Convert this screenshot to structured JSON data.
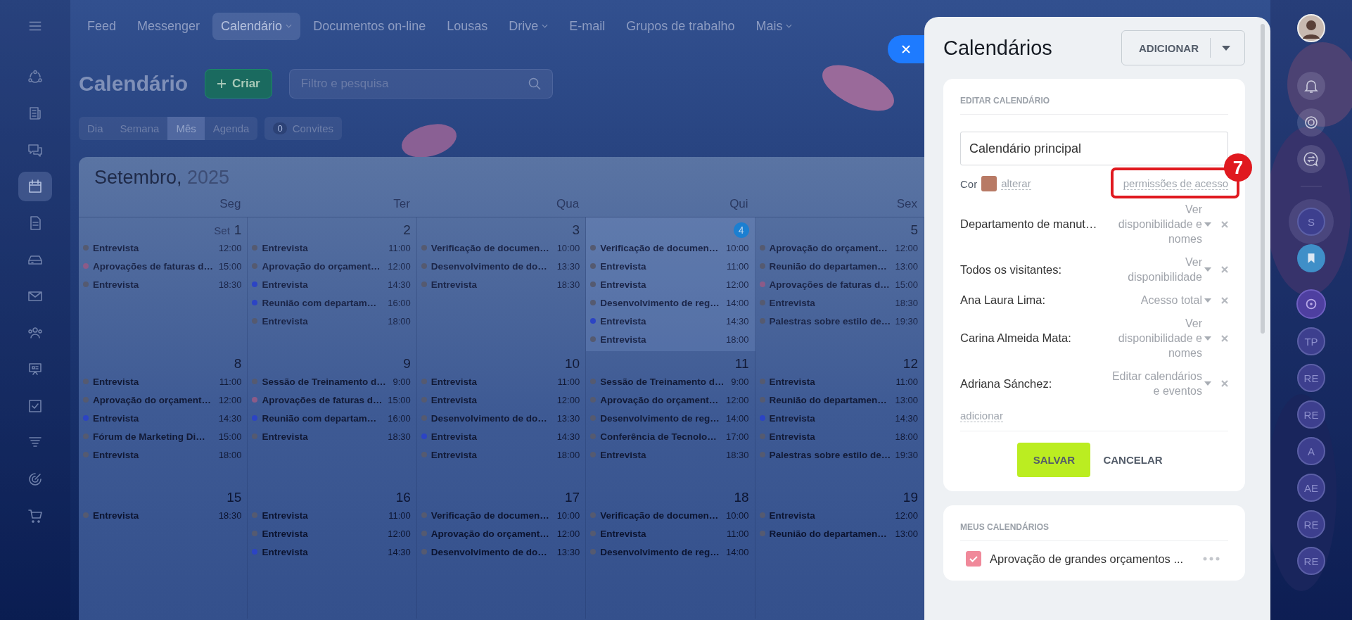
{
  "sidebar": {
    "items": [
      {
        "kind": "network",
        "selected": false
      },
      {
        "kind": "news",
        "selected": false
      },
      {
        "kind": "chat",
        "selected": false
      },
      {
        "kind": "calendar",
        "selected": true
      },
      {
        "kind": "document",
        "selected": false
      },
      {
        "kind": "drive",
        "selected": false
      },
      {
        "kind": "mail",
        "selected": false
      },
      {
        "kind": "people",
        "selected": false
      },
      {
        "kind": "board",
        "selected": false
      },
      {
        "kind": "tasks",
        "selected": false
      },
      {
        "kind": "funnel",
        "selected": false
      },
      {
        "kind": "target",
        "selected": false
      },
      {
        "kind": "cart",
        "selected": false
      }
    ]
  },
  "nav": {
    "items": [
      {
        "label": "Feed",
        "selected": false,
        "dropdown": false
      },
      {
        "label": "Messenger",
        "selected": false,
        "dropdown": false
      },
      {
        "label": "Calendário",
        "selected": true,
        "dropdown": true
      },
      {
        "label": "Documentos on-line",
        "selected": false,
        "dropdown": false
      },
      {
        "label": "Lousas",
        "selected": false,
        "dropdown": false
      },
      {
        "label": "Drive",
        "selected": false,
        "dropdown": true
      },
      {
        "label": "E-mail",
        "selected": false,
        "dropdown": false
      },
      {
        "label": "Grupos de trabalho",
        "selected": false,
        "dropdown": false
      },
      {
        "label": "Mais",
        "selected": false,
        "dropdown": true
      }
    ]
  },
  "header": {
    "title": "Calendário",
    "create_button": "Criar",
    "search": {
      "placeholder": "Filtro e pesquisa"
    }
  },
  "views": [
    {
      "label": "Dia",
      "selected": false
    },
    {
      "label": "Semana",
      "selected": false
    },
    {
      "label": "Mês",
      "selected": true
    },
    {
      "label": "Agenda",
      "selected": false
    }
  ],
  "invites": {
    "count": "0",
    "label": "Convites"
  },
  "calendar": {
    "month": "Setembro,",
    "year": "2025",
    "weekdays": [
      "Seg",
      "Ter",
      "Qua",
      "Qui",
      "Sex"
    ],
    "weeks": [
      {
        "days": [
          {
            "month": "Set",
            "number": "1",
            "today": false,
            "events": [
              {
                "title": "Entrevista",
                "time": "12:00",
                "color": "#555a70"
              },
              {
                "title": "Aprovações de faturas d…",
                "time": "15:00",
                "color": "#8c5b88"
              },
              {
                "title": "Entrevista",
                "time": "18:30",
                "color": "#555a70"
              }
            ]
          },
          {
            "number": "2",
            "today": false,
            "events": [
              {
                "title": "Entrevista",
                "time": "11:00",
                "color": "#555a70"
              },
              {
                "title": "Aprovação do orçament…",
                "time": "12:00",
                "color": "#555a70"
              },
              {
                "title": "Entrevista",
                "time": "14:30",
                "color": "#2c44c4"
              },
              {
                "title": "Reunião com departam…",
                "time": "16:00",
                "color": "#2c44c4"
              },
              {
                "title": "Entrevista",
                "time": "18:00",
                "color": "#555a70"
              }
            ]
          },
          {
            "number": "3",
            "today": false,
            "events": [
              {
                "title": "Verificação de documen…",
                "time": "10:00",
                "color": "#555a70"
              },
              {
                "title": "Desenvolvimento de do…",
                "time": "13:30",
                "color": "#555a70"
              },
              {
                "title": "Entrevista",
                "time": "18:30",
                "color": "#555a70"
              }
            ]
          },
          {
            "number": "4",
            "today": true,
            "events": [
              {
                "title": "Verificação de documen…",
                "time": "10:00",
                "color": "#555a70"
              },
              {
                "title": "Entrevista",
                "time": "11:00",
                "color": "#555a70"
              },
              {
                "title": "Entrevista",
                "time": "12:00",
                "color": "#555a70"
              },
              {
                "title": "Desenvolvimento de reg…",
                "time": "14:00",
                "color": "#555a70"
              },
              {
                "title": "Entrevista",
                "time": "14:30",
                "color": "#2c44c4"
              },
              {
                "title": "Entrevista",
                "time": "18:00",
                "color": "#555a70"
              }
            ]
          },
          {
            "number": "5",
            "today": false,
            "events": [
              {
                "title": "Aprovação do orçament…",
                "time": "12:00",
                "color": "#555a70"
              },
              {
                "title": "Reunião do departamen…",
                "time": "13:00",
                "color": "#555a70"
              },
              {
                "title": "Aprovações de faturas d…",
                "time": "15:00",
                "color": "#8c5b88"
              },
              {
                "title": "Entrevista",
                "time": "18:30",
                "color": "#555a70"
              },
              {
                "title": "Palestras sobre estilo de…",
                "time": "19:30",
                "color": "#555a70"
              }
            ]
          }
        ]
      },
      {
        "days": [
          {
            "number": "8",
            "today": false,
            "events": [
              {
                "title": "Entrevista",
                "time": "11:00",
                "color": "#555a70"
              },
              {
                "title": "Aprovação do orçament…",
                "time": "12:00",
                "color": "#555a70"
              },
              {
                "title": "Entrevista",
                "time": "14:30",
                "color": "#2c44c4"
              },
              {
                "title": "Fórum de Marketing Di…",
                "time": "15:00",
                "color": "#555a70"
              },
              {
                "title": "Entrevista",
                "time": "18:00",
                "color": "#555a70"
              }
            ]
          },
          {
            "number": "9",
            "today": false,
            "events": [
              {
                "title": "Sessão de Treinamento d…",
                "time": "9:00",
                "color": "#555a70"
              },
              {
                "title": "Aprovações de faturas d…",
                "time": "15:00",
                "color": "#8c5b88"
              },
              {
                "title": "Reunião com departam…",
                "time": "16:00",
                "color": "#2c44c4"
              },
              {
                "title": "Entrevista",
                "time": "18:30",
                "color": "#555a70"
              }
            ]
          },
          {
            "number": "10",
            "today": false,
            "events": [
              {
                "title": "Entrevista",
                "time": "11:00",
                "color": "#555a70"
              },
              {
                "title": "Entrevista",
                "time": "12:00",
                "color": "#555a70"
              },
              {
                "title": "Desenvolvimento de do…",
                "time": "13:30",
                "color": "#555a70"
              },
              {
                "title": "Entrevista",
                "time": "14:30",
                "color": "#2c44c4"
              },
              {
                "title": "Entrevista",
                "time": "18:00",
                "color": "#555a70"
              }
            ]
          },
          {
            "number": "11",
            "today": false,
            "events": [
              {
                "title": "Sessão de Treinamento d…",
                "time": "9:00",
                "color": "#555a70"
              },
              {
                "title": "Aprovação do orçament…",
                "time": "12:00",
                "color": "#555a70"
              },
              {
                "title": "Desenvolvimento de reg…",
                "time": "14:00",
                "color": "#555a70"
              },
              {
                "title": "Conferência de Tecnolo…",
                "time": "17:00",
                "color": "#555a70"
              },
              {
                "title": "Entrevista",
                "time": "18:30",
                "color": "#555a70"
              }
            ]
          },
          {
            "number": "12",
            "today": false,
            "events": [
              {
                "title": "Entrevista",
                "time": "11:00",
                "color": "#555a70"
              },
              {
                "title": "Reunião do departamen…",
                "time": "13:00",
                "color": "#555a70"
              },
              {
                "title": "Entrevista",
                "time": "14:30",
                "color": "#2c44c4"
              },
              {
                "title": "Entrevista",
                "time": "18:00",
                "color": "#555a70"
              },
              {
                "title": "Palestras sobre estilo de…",
                "time": "19:30",
                "color": "#555a70"
              }
            ]
          }
        ]
      },
      {
        "days": [
          {
            "number": "15",
            "today": false,
            "events": [
              {
                "title": "Entrevista",
                "time": "18:30",
                "color": "#555a70"
              }
            ]
          },
          {
            "number": "16",
            "today": false,
            "events": [
              {
                "title": "Entrevista",
                "time": "11:00",
                "color": "#555a70"
              },
              {
                "title": "Entrevista",
                "time": "12:00",
                "color": "#555a70"
              },
              {
                "title": "Entrevista",
                "time": "14:30",
                "color": "#2c44c4"
              }
            ]
          },
          {
            "number": "17",
            "today": false,
            "events": [
              {
                "title": "Verificação de documen…",
                "time": "10:00",
                "color": "#555a70"
              },
              {
                "title": "Aprovação do orçament…",
                "time": "12:00",
                "color": "#555a70"
              },
              {
                "title": "Desenvolvimento de do…",
                "time": "13:30",
                "color": "#555a70"
              }
            ]
          },
          {
            "number": "18",
            "today": false,
            "events": [
              {
                "title": "Verificação de documen…",
                "time": "10:00",
                "color": "#555a70"
              },
              {
                "title": "Entrevista",
                "time": "11:00",
                "color": "#555a70"
              },
              {
                "title": "Desenvolvimento de reg…",
                "time": "14:00",
                "color": "#555a70"
              }
            ]
          },
          {
            "number": "19",
            "today": false,
            "events": [
              {
                "title": "Entrevista",
                "time": "12:00",
                "color": "#555a70"
              },
              {
                "title": "Reunião do departamen…",
                "time": "13:00",
                "color": "#555a70"
              }
            ]
          }
        ]
      }
    ]
  },
  "panel": {
    "title": "Calendários",
    "add_button": "ADICIONAR",
    "edit": {
      "heading": "EDITAR CALENDÁRIO",
      "name_field": {
        "value": "Calendário principal"
      },
      "color_label": "Cor",
      "color": "#b87a65",
      "change_link": "alterar",
      "permissions_link": "permissões de acesso",
      "annotation": "7",
      "access": [
        {
          "name": "Departamento de manut…",
          "level": "Ver disponibilidade e nomes"
        },
        {
          "name": "Todos os visitantes:",
          "level": "Ver disponibilidade"
        },
        {
          "name": "Ana Laura Lima:",
          "level": "Acesso total"
        },
        {
          "name": "Carina Almeida Mata:",
          "level": "Ver disponibilidade e nomes"
        },
        {
          "name": "Adriana Sánchez:",
          "level": "Editar calendários e eventos"
        }
      ],
      "add_link": "adicionar",
      "save_button": "SALVAR",
      "cancel_button": "CANCELAR"
    },
    "my_calendars": {
      "heading": "MEUS CALENDÁRIOS",
      "items": [
        {
          "name": "Aprovação de grandes orçamentos ...",
          "checked": true
        }
      ]
    }
  },
  "right_bar": {
    "items": [
      {
        "kind": "avatar"
      },
      {
        "kind": "bell"
      },
      {
        "kind": "spiral"
      },
      {
        "kind": "chat"
      },
      {
        "kind": "letter",
        "initials": "S"
      },
      {
        "kind": "bookmark"
      },
      {
        "kind": "sync"
      },
      {
        "kind": "letter",
        "initials": "TP"
      },
      {
        "kind": "letter",
        "initials": "RE"
      },
      {
        "kind": "letter",
        "initials": "RE"
      },
      {
        "kind": "letter",
        "initials": "A"
      },
      {
        "kind": "letter",
        "initials": "AE"
      },
      {
        "kind": "letter",
        "initials": "RE"
      },
      {
        "kind": "letter",
        "initials": "RE"
      }
    ]
  }
}
